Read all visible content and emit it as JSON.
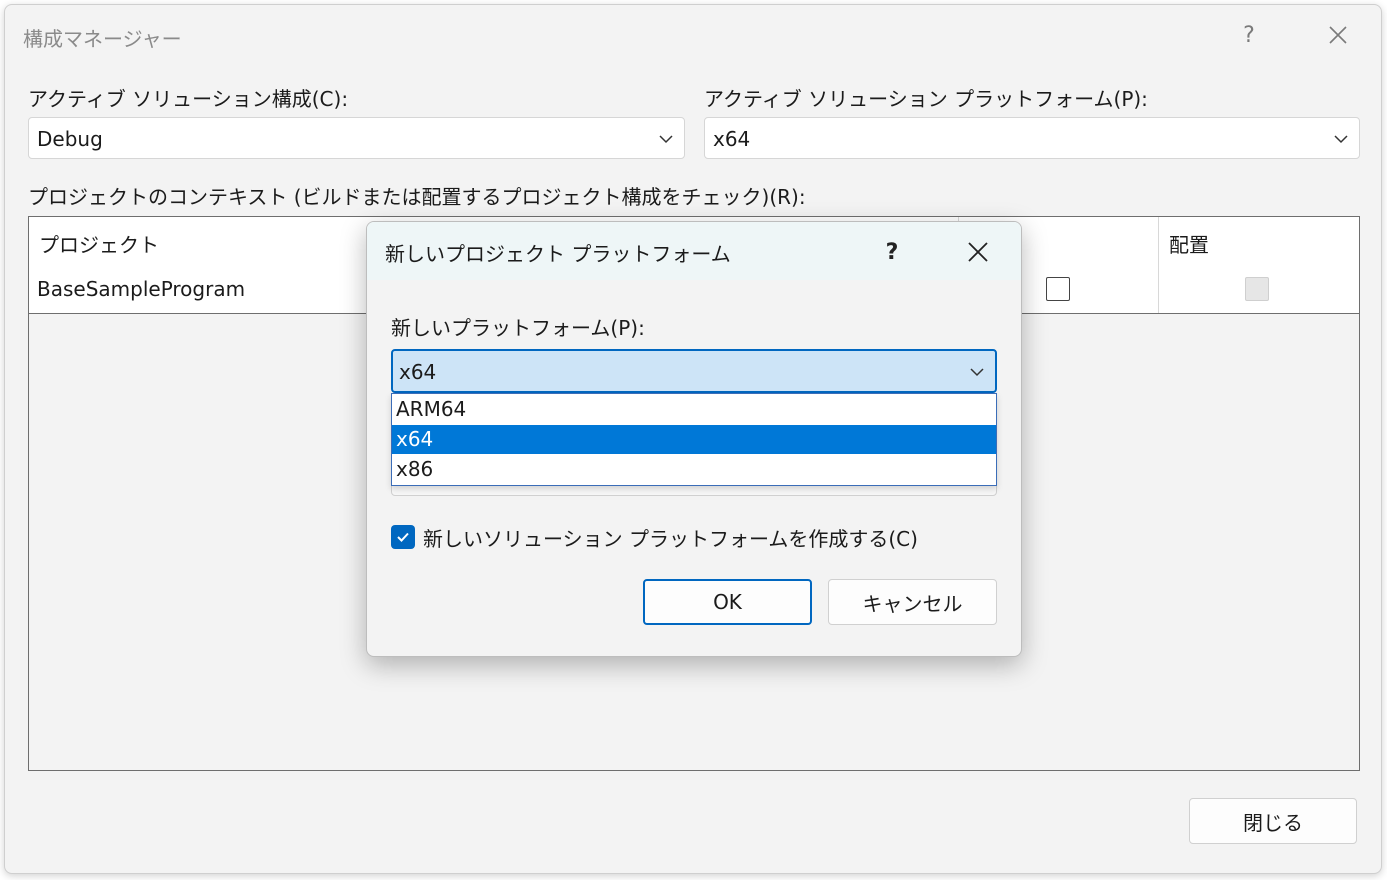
{
  "window": {
    "title": "構成マネージャー",
    "help_label": "?",
    "close_icon": "close-icon"
  },
  "active_config": {
    "label": "アクティブ ソリューション構成(C):",
    "value": "Debug"
  },
  "active_platform": {
    "label": "アクティブ ソリューション プラットフォーム(P):",
    "value": "x64"
  },
  "context": {
    "label": "プロジェクトのコンテキスト (ビルドまたは配置するプロジェクト構成をチェック)(R):",
    "columns": {
      "project": "プロジェクト",
      "deploy": "配置"
    },
    "rows": [
      {
        "project": "BaseSampleProgram",
        "build_checked": false,
        "deploy_checked": false,
        "deploy_enabled": false
      }
    ]
  },
  "close_button": {
    "label": "閉じる"
  },
  "modal": {
    "title": "新しいプロジェクト プラットフォーム",
    "help_label": "?",
    "new_platform_label": "新しいプラットフォーム(P):",
    "new_platform_value": "x64",
    "options": [
      "ARM64",
      "x64",
      "x86"
    ],
    "selected_index": 1,
    "create_solution_platform": {
      "label": "新しいソリューション プラットフォームを作成する(C)",
      "checked": true
    },
    "ok_label": "OK",
    "cancel_label": "キャンセル"
  },
  "colors": {
    "accent": "#0067c0",
    "selection": "#0078d7",
    "combo_focus_bg": "#cde4f7"
  }
}
